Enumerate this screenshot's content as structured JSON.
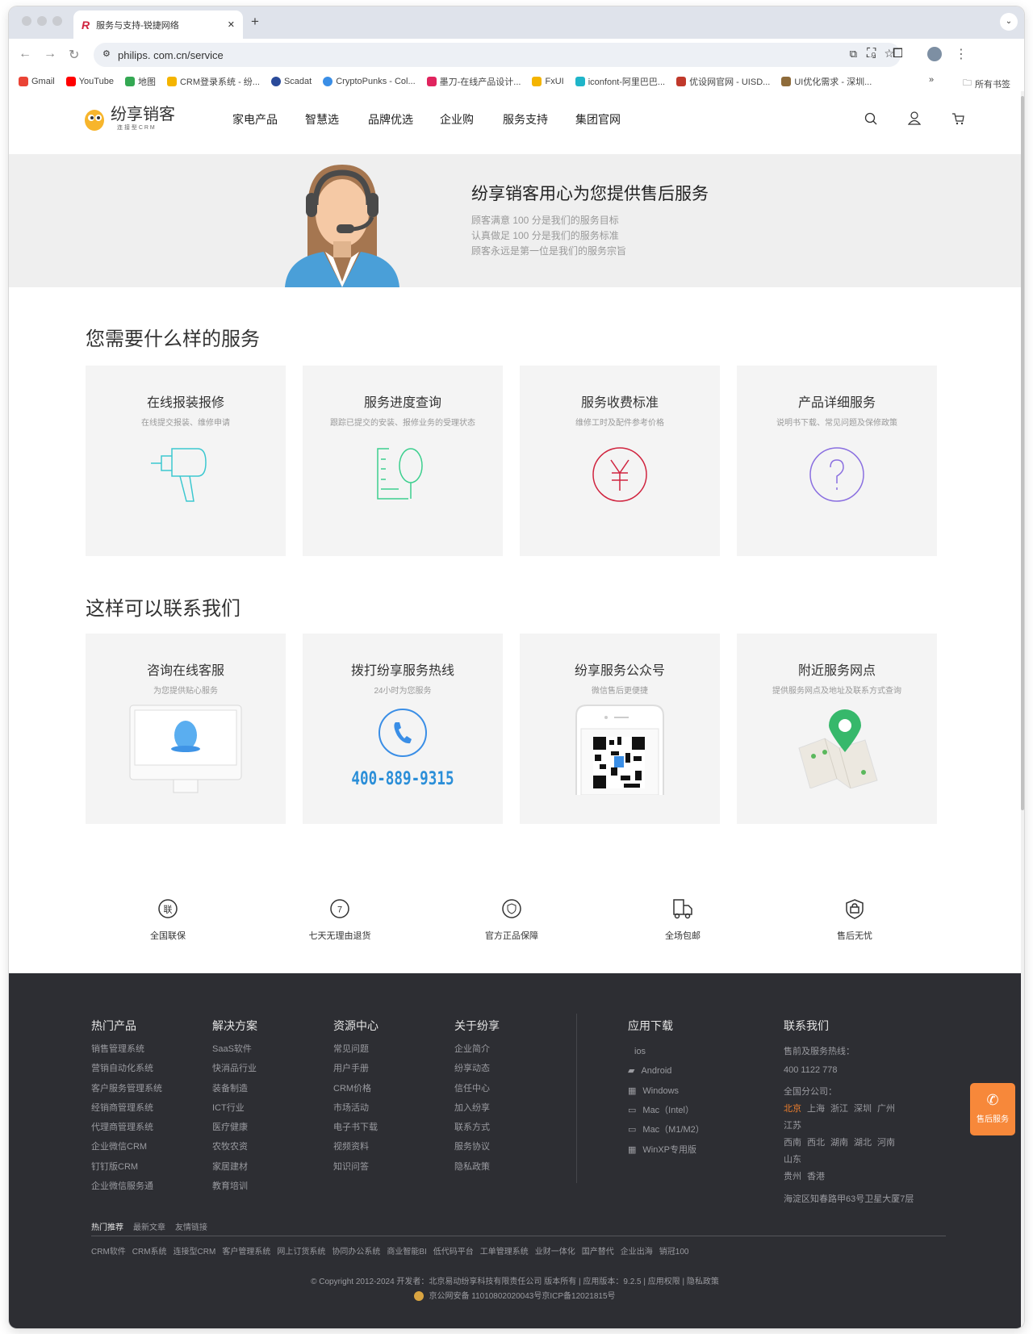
{
  "browser": {
    "tab_title": "服务与支持-锐捷网络",
    "url": "philips. com.cn/service",
    "bookmarks": [
      {
        "label": "Gmail",
        "color": "#ea4335"
      },
      {
        "label": "YouTube",
        "color": "#ff0000"
      },
      {
        "label": "地图",
        "color": "#34a853"
      },
      {
        "label": "CRM登录系统 - 纷...",
        "color": "#f4b400"
      },
      {
        "label": "Scadat",
        "color": "#2a4a9a"
      },
      {
        "label": "CryptoPunks - Col...",
        "color": "#3a8ee6"
      },
      {
        "label": "墨刀-在线产品设计...",
        "color": "#e0245e"
      },
      {
        "label": "FxUI",
        "color": "#f4b400"
      },
      {
        "label": "iconfont-阿里巴巴...",
        "color": "#1fb5c9"
      },
      {
        "label": "优设网官网 - UISD...",
        "color": "#c0392b"
      },
      {
        "label": "UI优化需求 - 深圳...",
        "color": "#8e6b3a"
      }
    ],
    "all_bookmarks": "所有书签",
    "more": "»"
  },
  "header": {
    "logo_text": "纷享销客",
    "logo_sub": "连 接 型 C R M",
    "nav": [
      "家电产品",
      "智慧选",
      "品牌优选",
      "企业购",
      "服务支持",
      "集团官网"
    ]
  },
  "hero": {
    "title": "纷享销客用心为您提供售后服务",
    "lines": [
      "顾客满意 100 分是我们的服务目标",
      "认真做足 100 分是我们的服务标准",
      "顾客永远是第一位是我们的服务宗旨"
    ]
  },
  "services": {
    "title": "您需要什么样的服务",
    "cards": [
      {
        "title": "在线报装报修",
        "desc": "在线提交报装、维修申请",
        "icon": "drill-icon",
        "color": "#3cc8d0"
      },
      {
        "title": "服务进度查询",
        "desc": "跟踪已提交的安装、报修业务的受理状态",
        "icon": "document-search-icon",
        "color": "#3ccf8e"
      },
      {
        "title": "服务收费标准",
        "desc": "维修工时及配件参考价格",
        "icon": "yen-icon",
        "color": "#d0243f"
      },
      {
        "title": "产品详细服务",
        "desc": "说明书下载、常见问题及保修政策",
        "icon": "question-icon",
        "color": "#8a6fe0"
      }
    ]
  },
  "contact": {
    "title": "这样可以联系我们",
    "cards": [
      {
        "title": "咨询在线客服",
        "desc": "为您提供贴心服务",
        "icon": "qq-monitor-icon"
      },
      {
        "title": "拨打纷享服务热线",
        "desc": "24小时为您服务",
        "icon": "phone-icon",
        "phone": "400-889-9315"
      },
      {
        "title": "纷享服务公众号",
        "desc": "微信售后更便捷",
        "icon": "qr-code-icon"
      },
      {
        "title": "附近服务网点",
        "desc": "提供服务网点及地址及联系方式查询",
        "icon": "map-pin-icon"
      }
    ]
  },
  "features": [
    {
      "label": "全国联保",
      "icon_text": "联"
    },
    {
      "label": "七天无理由退货",
      "icon_text": "7"
    },
    {
      "label": "官方正品保障"
    },
    {
      "label": "全场包邮"
    },
    {
      "label": "售后无忧"
    }
  ],
  "footer": {
    "columns": [
      {
        "title": "热门产品",
        "links": [
          "销售管理系统",
          "营销自动化系统",
          "客户服务管理系统",
          "经销商管理系统",
          "代理商管理系统",
          "企业微信CRM",
          "钉钉版CRM",
          "企业微信服务通"
        ]
      },
      {
        "title": "解决方案",
        "links": [
          "SaaS软件",
          "快消品行业",
          "装备制造",
          "ICT行业",
          "医疗健康",
          "农牧农资",
          "家居建材",
          "教育培训"
        ]
      },
      {
        "title": "资源中心",
        "links": [
          "常见问题",
          "用户手册",
          "CRM价格",
          "市场活动",
          "电子书下载",
          "视频资料",
          "知识问答"
        ]
      },
      {
        "title": "关于纷享",
        "links": [
          "企业简介",
          "纷享动态",
          "信任中心",
          "加入纷享",
          "联系方式",
          "服务协议",
          "隐私政策"
        ]
      }
    ],
    "apps": {
      "title": "应用下载",
      "items": [
        "ios",
        "Android",
        "Windows",
        "Mac（Intel）",
        "Mac（M1/M2）",
        "WinXP专用版"
      ]
    },
    "contact": {
      "title": "联系我们",
      "hotline_label": "售前及服务热线：",
      "hotline": "400 1122 778",
      "branches_label": "全国分公司：",
      "cities": [
        "北京",
        "上海",
        "浙江",
        "深圳",
        "广州",
        "江苏",
        "西南",
        "西北",
        "湖南",
        "湖北",
        "河南",
        "山东",
        "贵州",
        "香港"
      ],
      "active_city": "北京",
      "address": "海淀区知春路甲63号卫星大厦7层",
      "accent": "#f07f2c"
    },
    "tabs": [
      "热门推荐",
      "最新文章",
      "友情链接"
    ],
    "hot_links": [
      "CRM软件",
      "CRM系统",
      "连接型CRM",
      "客户管理系统",
      "网上订货系统",
      "协同办公系统",
      "商业智能BI",
      "低代码平台",
      "工单管理系统",
      "业财一体化",
      "国产替代",
      "企业出海",
      "销冠100"
    ],
    "copyright": "© Copyright 2012-2024 开发者：北京易动纷享科技有限责任公司 版本所有 | 应用版本：9.2.5 | 应用权限 | 隐私政策",
    "icp": "京公网安备 11010802020043号京ICP备12021815号"
  },
  "float_button": {
    "label": "售后服务",
    "color": "#f7883a"
  }
}
